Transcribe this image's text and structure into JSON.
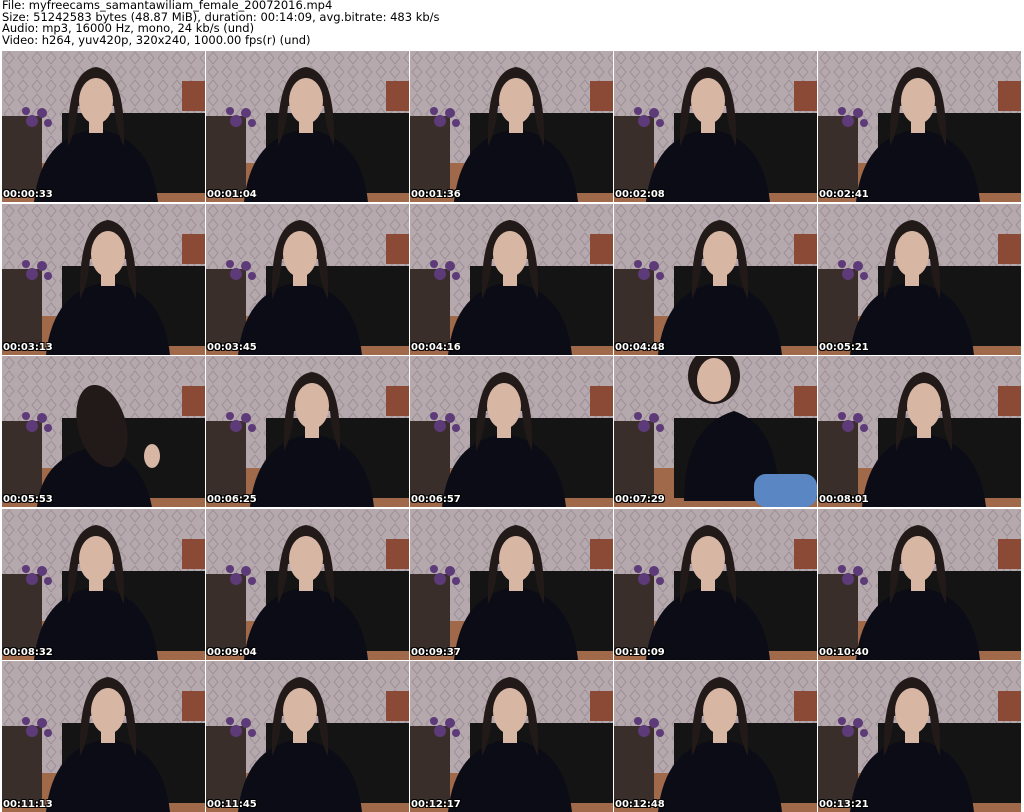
{
  "header": {
    "file": "File: myfreecams_samantawiliam_female_20072016.mp4",
    "size": "Size: 51242583 bytes (48.87 MiB), duration: 00:14:09, avg.bitrate: 483 kb/s",
    "audio": "Audio: mp3, 16000 Hz, mono, 24 kb/s (und)",
    "video": "Video: h264, yuv420p, 320x240, 1000.00 fps(r) (und)"
  },
  "thumbnails": [
    {
      "timestamp": "00:00:33",
      "variant": "a"
    },
    {
      "timestamp": "00:01:04",
      "variant": "a"
    },
    {
      "timestamp": "00:01:36",
      "variant": "a"
    },
    {
      "timestamp": "00:02:08",
      "variant": "a"
    },
    {
      "timestamp": "00:02:41",
      "variant": "a"
    },
    {
      "timestamp": "00:03:13",
      "variant": "a"
    },
    {
      "timestamp": "00:03:45",
      "variant": "a"
    },
    {
      "timestamp": "00:04:16",
      "variant": "a"
    },
    {
      "timestamp": "00:04:48",
      "variant": "a"
    },
    {
      "timestamp": "00:05:21",
      "variant": "a"
    },
    {
      "timestamp": "00:05:53",
      "variant": "c"
    },
    {
      "timestamp": "00:06:25",
      "variant": "a"
    },
    {
      "timestamp": "00:06:57",
      "variant": "a"
    },
    {
      "timestamp": "00:07:29",
      "variant": "b"
    },
    {
      "timestamp": "00:08:01",
      "variant": "a"
    },
    {
      "timestamp": "00:08:32",
      "variant": "a"
    },
    {
      "timestamp": "00:09:04",
      "variant": "a"
    },
    {
      "timestamp": "00:09:37",
      "variant": "a"
    },
    {
      "timestamp": "00:10:09",
      "variant": "a"
    },
    {
      "timestamp": "00:10:40",
      "variant": "a"
    },
    {
      "timestamp": "00:11:13",
      "variant": "a"
    },
    {
      "timestamp": "00:11:45",
      "variant": "a"
    },
    {
      "timestamp": "00:12:17",
      "variant": "a"
    },
    {
      "timestamp": "00:12:48",
      "variant": "a"
    },
    {
      "timestamp": "00:13:21",
      "variant": "a"
    }
  ],
  "colors": {
    "wallpaper": "#b5a9ae",
    "floor": "#a0694a",
    "shirt": "#0c0c16",
    "hair": "#221a18",
    "skin": "#d8b6a4",
    "sofa": "#141414",
    "flowers": "#5d3a78",
    "jeans": "#5a86c4"
  }
}
